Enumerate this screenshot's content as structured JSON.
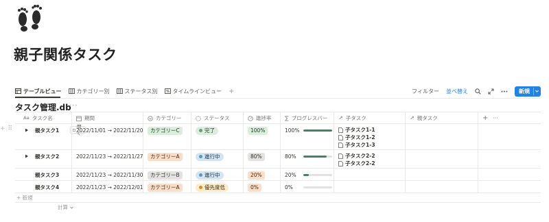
{
  "page": {
    "icon": "footprints-icon",
    "title": "親子関係タスク"
  },
  "views": {
    "tabs": [
      {
        "label": "テーブルビュー",
        "icon": "table-icon",
        "active": true
      },
      {
        "label": "カテゴリー別",
        "icon": "board-icon",
        "active": false
      },
      {
        "label": "ステータス別",
        "icon": "board-icon",
        "active": false
      },
      {
        "label": "タイムラインビュー",
        "icon": "timeline-icon",
        "active": false
      }
    ],
    "add": "+"
  },
  "toolbar": {
    "filter": "フィルター",
    "sort": "並べ替え",
    "new_button": "新規"
  },
  "database": {
    "title": "タスク管理.db",
    "more": "···"
  },
  "columns": [
    {
      "label": "タスク名",
      "icon": "title-aa-icon",
      "icon_text": "Aa"
    },
    {
      "label": "期間",
      "icon": "calendar-icon"
    },
    {
      "label": "カテゴリー",
      "icon": "select-icon"
    },
    {
      "label": "ステータス",
      "icon": "status-icon"
    },
    {
      "label": "進捗率",
      "icon": "number-icon"
    },
    {
      "label": "プログレスバー",
      "icon": "formula-sigma-icon",
      "icon_text": "∑"
    },
    {
      "label": "子タスク",
      "icon": "relation-arrow-icon",
      "icon_text": "↗"
    },
    {
      "label": "親タスク",
      "icon": "relation-arrow-icon",
      "icon_text": "↗"
    }
  ],
  "header_add": "+",
  "header_more": "···",
  "rows": [
    {
      "name": "親タスク1",
      "has_toggle": true,
      "open_label": "開く",
      "period": "2022/11/01 → 2022/11/20",
      "category": "カテゴリーC",
      "status": "完了",
      "progress_text": "100%",
      "progress_label": "100%",
      "progress_fraction": 1.0,
      "children": [
        "子タスク1-1",
        "子タスク1-2",
        "子タスク1-3"
      ],
      "parent": ""
    },
    {
      "name": "親タスク2",
      "has_toggle": true,
      "period": "2022/11/23 → 2022/11/27",
      "category": "カテゴリーA",
      "status": "進行中",
      "progress_text": "80%",
      "progress_label": "80%",
      "progress_fraction": 0.8,
      "children": [
        "子タスク2-2",
        "子タスク2-2"
      ],
      "parent": ""
    },
    {
      "name": "親タスク3",
      "has_toggle": false,
      "period": "2022/11/23 → 2022/11/30",
      "category": "カテゴリーB",
      "status": "進行中",
      "progress_text": "20%",
      "progress_label": "20%",
      "progress_fraction": 0.2,
      "children": [],
      "parent": ""
    },
    {
      "name": "親タスク4",
      "has_toggle": false,
      "period": "2022/11/23 → 2022/12/01",
      "category": "カテゴリーA",
      "status": "優先度低",
      "progress_text": "0%",
      "progress_label": "0%",
      "progress_fraction": 0.0,
      "children": [],
      "parent": ""
    }
  ],
  "new_row": "+ 新規",
  "calculate": "計算",
  "colors": {
    "accent": "#2383e2",
    "progress_fill": "#448361",
    "category_C_bg": "#dbeddb",
    "category_C_fg": "#1c3829",
    "category_A_bg": "#fadec9",
    "category_A_fg": "#49290e",
    "category_B_bg": "#e3e2e0",
    "category_B_fg": "#32302c",
    "status_done_bg": "#dbeddb",
    "status_done_dot": "#6c9b7d",
    "status_progress_bg": "#d3e5ef",
    "status_progress_dot": "#5b97bd",
    "status_low_bg": "#fdecc8",
    "status_low_dot": "#cb912f",
    "pct_100_bg": "#dbeddb",
    "pct_80_bg": "#e3e2e0",
    "pct_20_bg": "#fadec9",
    "pct_0_bg": "#fadec9"
  }
}
